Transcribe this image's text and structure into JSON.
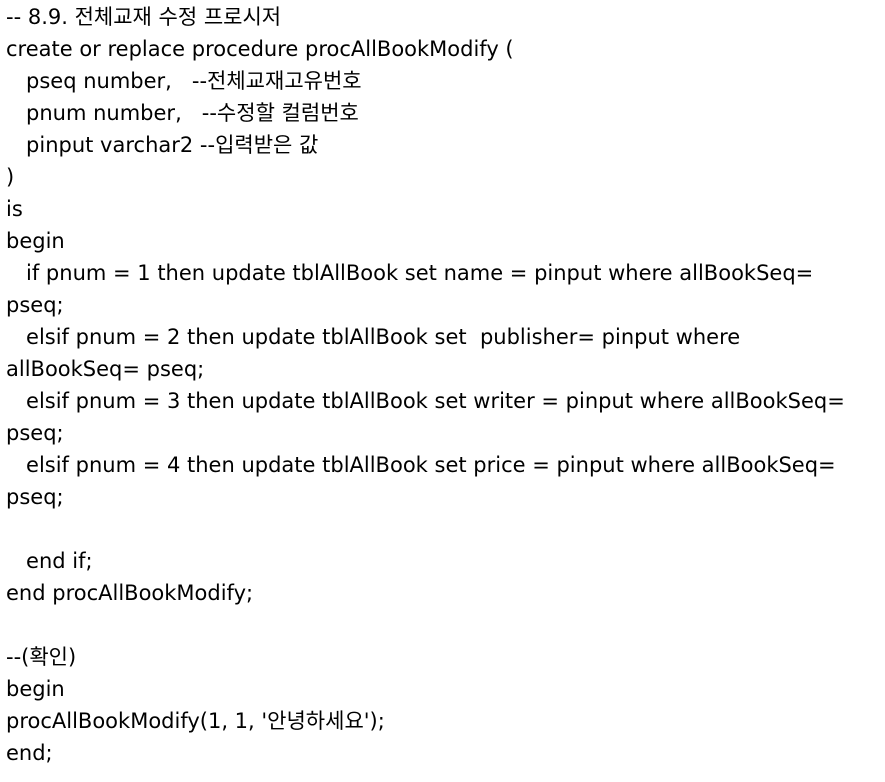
{
  "document": {
    "lines": [
      "-- 8.9. 전체교재 수정 프로시저",
      "create or replace procedure procAllBookModify (",
      "   pseq number,   --전체교재고유번호",
      "   pnum number,   --수정할 컬럼번호",
      "   pinput varchar2 --입력받은 값",
      ")",
      "is",
      "begin",
      "   if pnum = 1 then update tblAllBook set name = pinput where allBookSeq=",
      "pseq;",
      "   elsif pnum = 2 then update tblAllBook set  publisher= pinput where",
      "allBookSeq= pseq;",
      "   elsif pnum = 3 then update tblAllBook set writer = pinput where allBookSeq=",
      "pseq;",
      "   elsif pnum = 4 then update tblAllBook set price = pinput where allBookSeq=",
      "pseq;",
      "",
      "   end if;",
      "end procAllBookModify;",
      "",
      "--(확인)",
      "begin",
      "procAllBookModify(1, 1, '안녕하세요');",
      "end;"
    ]
  }
}
